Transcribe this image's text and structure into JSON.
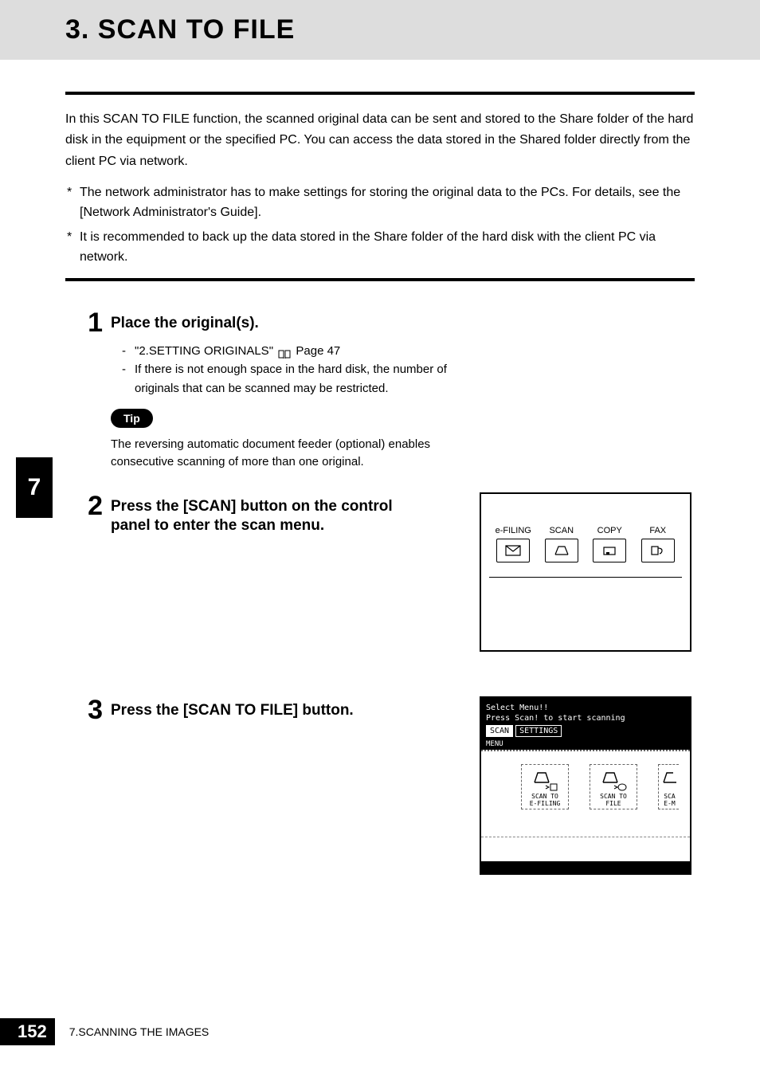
{
  "chapter_tab": "7",
  "title": "3. SCAN TO FILE",
  "intro": "In this SCAN TO FILE function, the scanned original data can be sent and stored to the Share folder of the hard disk in the equipment or the specified PC. You can access the data stored in the Shared folder directly from the client PC via network.",
  "notes": [
    "The network administrator has to make settings for storing the original data to the PCs. For details, see the [Network Administrator's Guide].",
    "It is recommended to back up the data stored in the Share folder of the hard disk with the client PC via network."
  ],
  "steps": [
    {
      "num": "1",
      "title": "Place the original(s).",
      "subs": [
        {
          "text_pre": "\"2.SETTING ORIGINALS\"",
          "page_ref": "Page 47",
          "has_icon": true
        },
        {
          "text_pre": "If there is not enough space in the hard disk, the number of originals that can be scanned may be restricted."
        }
      ],
      "tip_label": "Tip",
      "tip_text": "The reversing automatic document feeder (optional) enables consecutive scanning of more than one original."
    },
    {
      "num": "2",
      "title": "Press the [SCAN] button on the control panel to enter the scan menu.",
      "panel": {
        "labels": [
          "e-FILING",
          "SCAN",
          "COPY",
          "FAX"
        ]
      }
    },
    {
      "num": "3",
      "title": "Press the [SCAN TO FILE] button.",
      "screen": {
        "line1": "Select Menu!!",
        "line2": "Press Scan! to start scanning",
        "tabs": [
          "SCAN",
          "SETTINGS"
        ],
        "menu_label": "MENU",
        "buttons": [
          {
            "l1": "SCAN TO",
            "l2": "E-FILING"
          },
          {
            "l1": "SCAN TO",
            "l2": "FILE"
          },
          {
            "l1": "SCA",
            "l2": "E-M"
          }
        ]
      }
    }
  ],
  "footer": {
    "page_num": "152",
    "chapter": "7.SCANNING THE IMAGES"
  }
}
